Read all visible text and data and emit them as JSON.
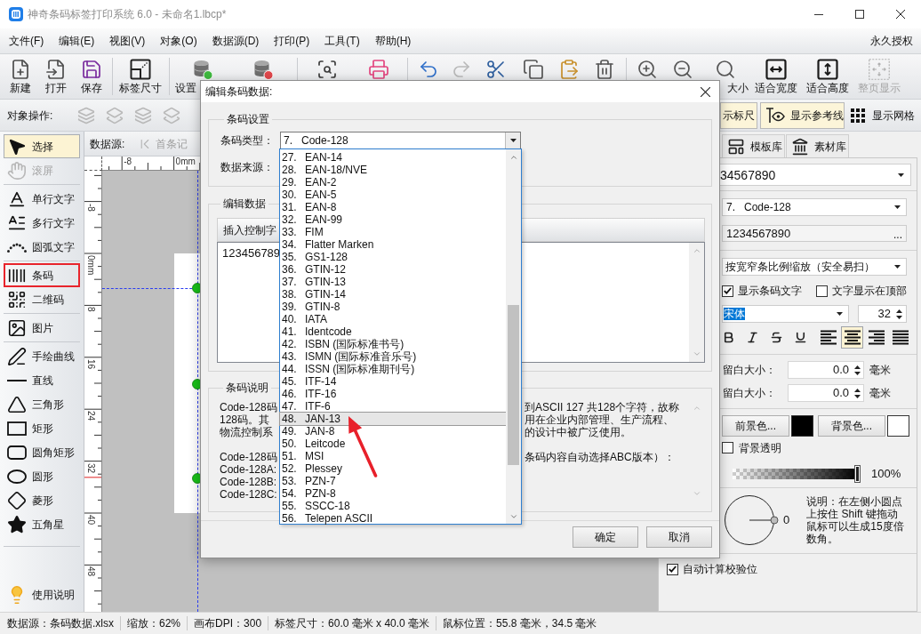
{
  "window": {
    "title": "神奇条码标签打印系统 6.0 - 未命名1.lbcp*"
  },
  "menu": {
    "items": [
      "文件(F)",
      "编辑(E)",
      "视图(V)",
      "对象(O)",
      "数据源(D)",
      "打印(P)",
      "工具(T)",
      "帮助(H)"
    ],
    "license": "永久授权"
  },
  "toolbar": [
    [
      {
        "label": "新建",
        "disabled": false
      },
      {
        "label": "打开",
        "disabled": false
      },
      {
        "label": "保存",
        "disabled": false
      }
    ],
    [
      {
        "label": "标签尺寸",
        "disabled": false
      }
    ],
    [
      {
        "label": "设置",
        "disabled": false
      },
      {
        "disabled": false
      }
    ],
    [
      {
        "disabled": false
      },
      {
        "disabled": false
      }
    ],
    [
      {
        "disabled": false
      },
      {
        "disabled": true
      },
      {
        "disabled": false
      },
      {
        "disabled": false
      },
      {
        "disabled": false
      },
      {
        "disabled": false
      }
    ],
    [
      {
        "disabled": false
      },
      {
        "disabled": false
      },
      {
        "label": "大小",
        "disabled": false
      },
      {
        "label": "适合宽度",
        "disabled": false
      },
      {
        "label": "适合高度",
        "disabled": false
      },
      {
        "label": "整页显示",
        "disabled": true
      }
    ]
  ],
  "object_bar": {
    "label": "对象操作:",
    "layer_tools": [
      {
        "disabled": true
      },
      {
        "disabled": true
      },
      {
        "disabled": true
      },
      {
        "disabled": true
      }
    ],
    "view_toggles": [
      {
        "label": "示标尺",
        "on": true
      },
      {
        "label": "显示参考线",
        "on": true
      },
      {
        "label": "显示网格",
        "on": false
      }
    ]
  },
  "tools": [
    [
      {
        "label": "选择",
        "selected": true,
        "disabled": false,
        "highlighted": false
      },
      {
        "label": "滚屏",
        "selected": false,
        "disabled": true,
        "highlighted": false
      }
    ],
    [
      {
        "label": "单行文字",
        "selected": false,
        "disabled": false,
        "highlighted": false
      },
      {
        "label": "多行文字",
        "selected": false,
        "disabled": false,
        "highlighted": false
      },
      {
        "label": "圆弧文字",
        "selected": false,
        "disabled": false,
        "highlighted": false
      }
    ],
    [
      {
        "label": "条码",
        "selected": false,
        "disabled": false,
        "highlighted": true
      },
      {
        "label": "二维码",
        "selected": false,
        "disabled": false,
        "highlighted": false
      }
    ],
    [
      {
        "label": "图片",
        "selected": false,
        "disabled": false,
        "highlighted": false
      }
    ],
    [
      {
        "label": "手绘曲线",
        "selected": false,
        "disabled": false,
        "highlighted": false
      },
      {
        "label": "直线",
        "selected": false,
        "disabled": false,
        "highlighted": false
      },
      {
        "label": "三角形",
        "selected": false,
        "disabled": false,
        "highlighted": false
      },
      {
        "label": "矩形",
        "selected": false,
        "disabled": false,
        "highlighted": false
      },
      {
        "label": "圆角矩形",
        "selected": false,
        "disabled": false,
        "highlighted": false
      },
      {
        "label": "圆形",
        "selected": false,
        "disabled": false,
        "highlighted": false
      },
      {
        "label": "菱形",
        "selected": false,
        "disabled": false,
        "highlighted": false
      },
      {
        "label": "五角星",
        "selected": false,
        "disabled": false,
        "highlighted": false
      }
    ]
  ],
  "help": {
    "label": "使用说明"
  },
  "canvas": {
    "data_source_label": "数据源:",
    "first_record": {
      "label": "首条记",
      "disabled": true
    },
    "rulers": {
      "horizontal": [
        "-8",
        "0mm"
      ],
      "vertical": [
        "-8",
        "0mm",
        "8",
        "16",
        "24",
        "32",
        "40",
        "48"
      ]
    }
  },
  "right_panel": {
    "tabs": [
      {
        "label": "模板库",
        "selected": false
      },
      {
        "label": "素材库",
        "selected": false
      }
    ],
    "data_combo": "34567890",
    "barcode_type": {
      "number": "7.",
      "name": "Code-128"
    },
    "barcode_data": "1234567890",
    "more_button": "...",
    "scale_mode": "按宽窄条比例缩放（安全易扫）",
    "text_options": [
      {
        "label": "显示条码文字",
        "checked": true
      },
      {
        "label": "文字显示在顶部",
        "checked": false
      }
    ],
    "font": {
      "name": "宋体",
      "text_selected": true,
      "size": "32"
    },
    "format_buttons": [
      {
        "kind": "bold",
        "selected": false
      },
      {
        "kind": "italic",
        "selected": false
      },
      {
        "kind": "strike",
        "selected": false
      },
      {
        "kind": "underline",
        "selected": false
      }
    ],
    "align_buttons": [
      {
        "kind": "left",
        "selected": false
      },
      {
        "kind": "center",
        "selected": true
      },
      {
        "kind": "right",
        "selected": false
      },
      {
        "kind": "justify",
        "selected": false
      }
    ],
    "margins": [
      {
        "label": "留白大小：",
        "value": "0.0",
        "unit": "毫米"
      },
      {
        "label": "留白大小：",
        "value": "0.0",
        "unit": "毫米"
      }
    ],
    "colors": [
      {
        "label": "前景色...",
        "color": "#000000"
      },
      {
        "label": "背景色...",
        "color": "#ffffff"
      }
    ],
    "transparent_bg": {
      "label": "背景透明",
      "checked": false
    },
    "opacity": {
      "level": 1,
      "reading": "100%"
    },
    "rotation": {
      "reading": "0",
      "note": "说明：在左侧小圆点上按住 Shift 键拖动鼠标可以生成15度倍数角。"
    },
    "auto_check_digit": {
      "label": "自动计算校验位",
      "checked": true
    }
  },
  "dialog": {
    "title": "编辑条码数据:",
    "settings": {
      "legend": "条码设置",
      "type_label": "条码类型：",
      "type_value": {
        "number": "7.",
        "name": "Code-128"
      },
      "source_label": "数据来源：",
      "options": [
        {
          "number": "27.",
          "name": "EAN-14",
          "selected": false
        },
        {
          "number": "28.",
          "name": "EAN-18/NVE",
          "selected": false
        },
        {
          "number": "29.",
          "name": "EAN-2",
          "selected": false
        },
        {
          "number": "30.",
          "name": "EAN-5",
          "selected": false
        },
        {
          "number": "31.",
          "name": "EAN-8",
          "selected": false
        },
        {
          "number": "32.",
          "name": "EAN-99",
          "selected": false
        },
        {
          "number": "33.",
          "name": "FIM",
          "selected": false
        },
        {
          "number": "34.",
          "name": "Flatter Marken",
          "selected": false
        },
        {
          "number": "35.",
          "name": "GS1-128",
          "selected": false
        },
        {
          "number": "36.",
          "name": "GTIN-12",
          "selected": false
        },
        {
          "number": "37.",
          "name": "GTIN-13",
          "selected": false
        },
        {
          "number": "38.",
          "name": "GTIN-14",
          "selected": false
        },
        {
          "number": "39.",
          "name": "GTIN-8",
          "selected": false
        },
        {
          "number": "40.",
          "name": "IATA",
          "selected": false
        },
        {
          "number": "41.",
          "name": "Identcode",
          "selected": false
        },
        {
          "number": "42.",
          "name": "ISBN (国际标准书号)",
          "selected": false
        },
        {
          "number": "43.",
          "name": "ISMN (国际标准音乐号)",
          "selected": false
        },
        {
          "number": "44.",
          "name": "ISSN (国际标准期刊号)",
          "selected": false
        },
        {
          "number": "45.",
          "name": "ITF-14",
          "selected": false
        },
        {
          "number": "46.",
          "name": "ITF-16",
          "selected": false
        },
        {
          "number": "47.",
          "name": "ITF-6",
          "selected": false
        },
        {
          "number": "48.",
          "name": "JAN-13",
          "selected": true
        },
        {
          "number": "49.",
          "name": "JAN-8",
          "selected": false
        },
        {
          "number": "50.",
          "name": "Leitcode",
          "selected": false
        },
        {
          "number": "51.",
          "name": "MSI",
          "selected": false
        },
        {
          "number": "52.",
          "name": "Plessey",
          "selected": false
        },
        {
          "number": "53.",
          "name": "PZN-7",
          "selected": false
        },
        {
          "number": "54.",
          "name": "PZN-8",
          "selected": false
        },
        {
          "number": "55.",
          "name": "SSCC-18",
          "selected": false
        },
        {
          "number": "56.",
          "name": "Telepen ASCII",
          "selected": false
        }
      ]
    },
    "data": {
      "legend": "编辑数据",
      "insert_button": "插入控制字",
      "value": "123456789"
    },
    "description": {
      "legend": "条码说明",
      "paragraphs": [
        {
          "left": [
            "Code-128码",
            "128码。其",
            "物流控制系"
          ],
          "right": [
            "到ASCII 127 共128个字符，故称",
            "用在企业内部管理、生产流程、",
            "的设计中被广泛使用。"
          ]
        },
        {
          "left": [
            "Code-128码",
            "Code-128A:",
            "Code-128B:",
            "Code-128C:"
          ],
          "right": [
            "条码内容自动选择ABC版本）："
          ]
        }
      ]
    },
    "buttons": [
      "确定",
      "取消"
    ]
  },
  "status_bar": [
    "数据源：条码数据.xlsx",
    "缩放：62%",
    "画布DPI：300",
    "标签尺寸：60.0 毫米 x 40.0 毫米",
    "鼠标位置：55.8 毫米，34.5 毫米"
  ]
}
